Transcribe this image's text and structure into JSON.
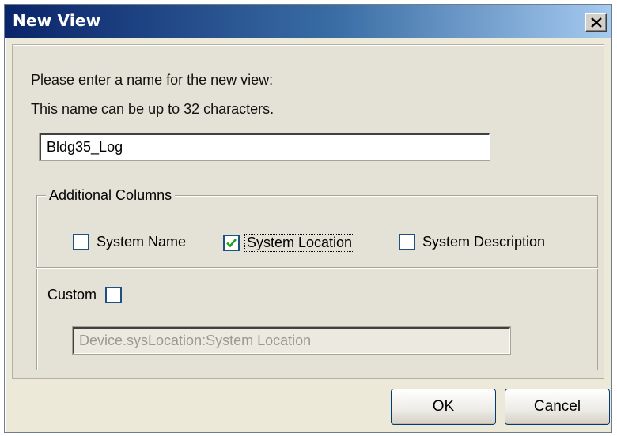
{
  "window": {
    "title": "New View",
    "close_icon": "close-icon"
  },
  "instructions": {
    "line1": "Please enter a name for the new view:",
    "line2": "This name can be up to 32 characters."
  },
  "view_name": {
    "value": "Bldg35_Log"
  },
  "additional_columns": {
    "legend": "Additional Columns",
    "options": [
      {
        "label": "System Name",
        "checked": false
      },
      {
        "label": "System Location",
        "checked": true
      },
      {
        "label": "System Description",
        "checked": false
      }
    ]
  },
  "custom": {
    "label": "Custom",
    "checked": false,
    "value": "Device.sysLocation:System Location"
  },
  "buttons": {
    "ok": "OK",
    "cancel": "Cancel"
  },
  "colors": {
    "title_gradient_start": "#0a246a",
    "title_gradient_end": "#a6caf0",
    "checkmark": "#21a121",
    "dialog_bg": "#ece9d8"
  }
}
